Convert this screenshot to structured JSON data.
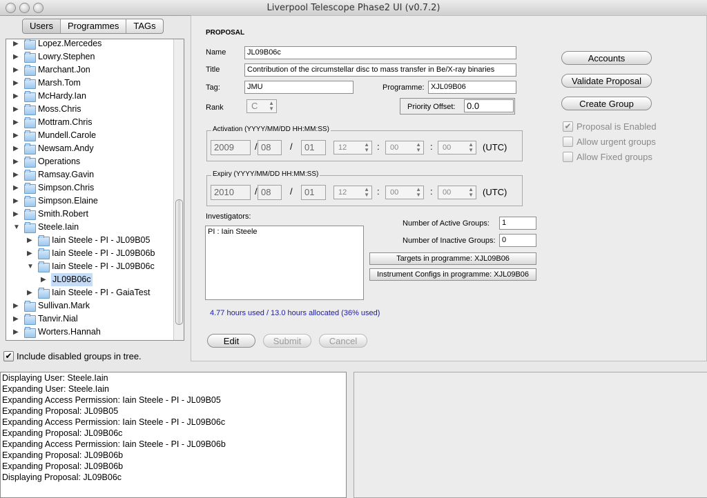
{
  "window": {
    "title": "Liverpool Telescope Phase2 UI (v0.7.2)"
  },
  "tabs": [
    {
      "label": "Users",
      "selected": true
    },
    {
      "label": "Programmes",
      "selected": false
    },
    {
      "label": "TAGs",
      "selected": false
    }
  ],
  "tree": [
    {
      "label": "Lopez.Mercedes",
      "depth": 0,
      "expanded": false,
      "selected": false
    },
    {
      "label": "Lowry.Stephen",
      "depth": 0,
      "expanded": false,
      "selected": false
    },
    {
      "label": "Marchant.Jon",
      "depth": 0,
      "expanded": false,
      "selected": false
    },
    {
      "label": "Marsh.Tom",
      "depth": 0,
      "expanded": false,
      "selected": false
    },
    {
      "label": "McHardy.Ian",
      "depth": 0,
      "expanded": false,
      "selected": false
    },
    {
      "label": "Moss.Chris",
      "depth": 0,
      "expanded": false,
      "selected": false
    },
    {
      "label": "Mottram.Chris",
      "depth": 0,
      "expanded": false,
      "selected": false
    },
    {
      "label": "Mundell.Carole",
      "depth": 0,
      "expanded": false,
      "selected": false
    },
    {
      "label": "Newsam.Andy",
      "depth": 0,
      "expanded": false,
      "selected": false
    },
    {
      "label": "Operations",
      "depth": 0,
      "expanded": false,
      "selected": false
    },
    {
      "label": "Ramsay.Gavin",
      "depth": 0,
      "expanded": false,
      "selected": false
    },
    {
      "label": "Simpson.Chris",
      "depth": 0,
      "expanded": false,
      "selected": false
    },
    {
      "label": "Simpson.Elaine",
      "depth": 0,
      "expanded": false,
      "selected": false
    },
    {
      "label": "Smith.Robert",
      "depth": 0,
      "expanded": false,
      "selected": false
    },
    {
      "label": "Steele.Iain",
      "depth": 0,
      "expanded": true,
      "selected": false
    },
    {
      "label": "Iain Steele - PI - JL09B05",
      "depth": 1,
      "expanded": false,
      "selected": false
    },
    {
      "label": "Iain Steele - PI - JL09B06b",
      "depth": 1,
      "expanded": false,
      "selected": false
    },
    {
      "label": "Iain Steele - PI - JL09B06c",
      "depth": 1,
      "expanded": true,
      "selected": false
    },
    {
      "label": "JL09B06c",
      "depth": 2,
      "expanded": false,
      "selected": true,
      "leaf": true
    },
    {
      "label": "Iain Steele - PI - GaiaTest",
      "depth": 1,
      "expanded": false,
      "selected": false
    },
    {
      "label": "Sullivan.Mark",
      "depth": 0,
      "expanded": false,
      "selected": false
    },
    {
      "label": "Tanvir.Nial",
      "depth": 0,
      "expanded": false,
      "selected": false
    },
    {
      "label": "Worters.Hannah",
      "depth": 0,
      "expanded": false,
      "selected": false
    }
  ],
  "include_disabled": {
    "label": "Include disabled groups in tree.",
    "checked": true
  },
  "proposal": {
    "heading": "PROPOSAL",
    "name_label": "Name",
    "name": "JL09B06c",
    "title_label": "Title",
    "title": "Contribution of the circumstellar disc to mass transfer in Be/X-ray binaries",
    "tag_label": "Tag:",
    "tag": "JMU",
    "programme_label": "Programme:",
    "programme": "XJL09B06",
    "rank_label": "Rank",
    "rank": "C",
    "priority_label": "Priority Offset:",
    "priority": "0.0",
    "activation": {
      "caption": "Activation (YYYY/MM/DD HH:MM:SS)",
      "year": "2009",
      "month": "08",
      "day": "01",
      "hour": "12",
      "minute": "00",
      "second": "00",
      "utc": "(UTC)"
    },
    "expiry": {
      "caption": "Expiry (YYYY/MM/DD HH:MM:SS)",
      "year": "2010",
      "month": "08",
      "day": "01",
      "hour": "12",
      "minute": "00",
      "second": "00",
      "utc": "(UTC)"
    },
    "investigators_label": "Investigators:",
    "investigators": [
      "PI : Iain Steele"
    ],
    "active_groups_label": "Number of Active Groups:",
    "active_groups": "1",
    "inactive_groups_label": "Number of Inactive Groups:",
    "inactive_groups": "0",
    "targets_button": "Targets in programme: XJL09B06",
    "instconfig_button": "Instrument Configs in programme: XJL09B06",
    "hours_used": "4.77 hours used / 13.0 hours allocated (36% used)",
    "edit": "Edit",
    "submit": "Submit",
    "cancel": "Cancel"
  },
  "actions": {
    "accounts": "Accounts",
    "validate": "Validate Proposal",
    "create_group": "Create Group",
    "enabled_label": "Proposal is Enabled",
    "enabled": true,
    "urgent_label": "Allow urgent groups",
    "urgent": false,
    "fixed_label": "Allow Fixed groups",
    "fixed": false
  },
  "console": [
    "Displaying User: Steele.Iain",
    "Expanding User: Steele.Iain",
    "Expanding Access Permission: Iain Steele - PI - JL09B05",
    "Expanding Proposal: JL09B05",
    "Expanding Access Permission: Iain Steele - PI - JL09B06c",
    "Expanding Proposal: JL09B06c",
    "Expanding Access Permission: Iain Steele - PI - JL09B06b",
    "Expanding Proposal: JL09B06b",
    "Expanding Proposal: JL09B06b",
    "Displaying Proposal: JL09B06c"
  ],
  "colors": {
    "link_blue": "#1a1aa6",
    "selection": "#c5dcf8"
  }
}
